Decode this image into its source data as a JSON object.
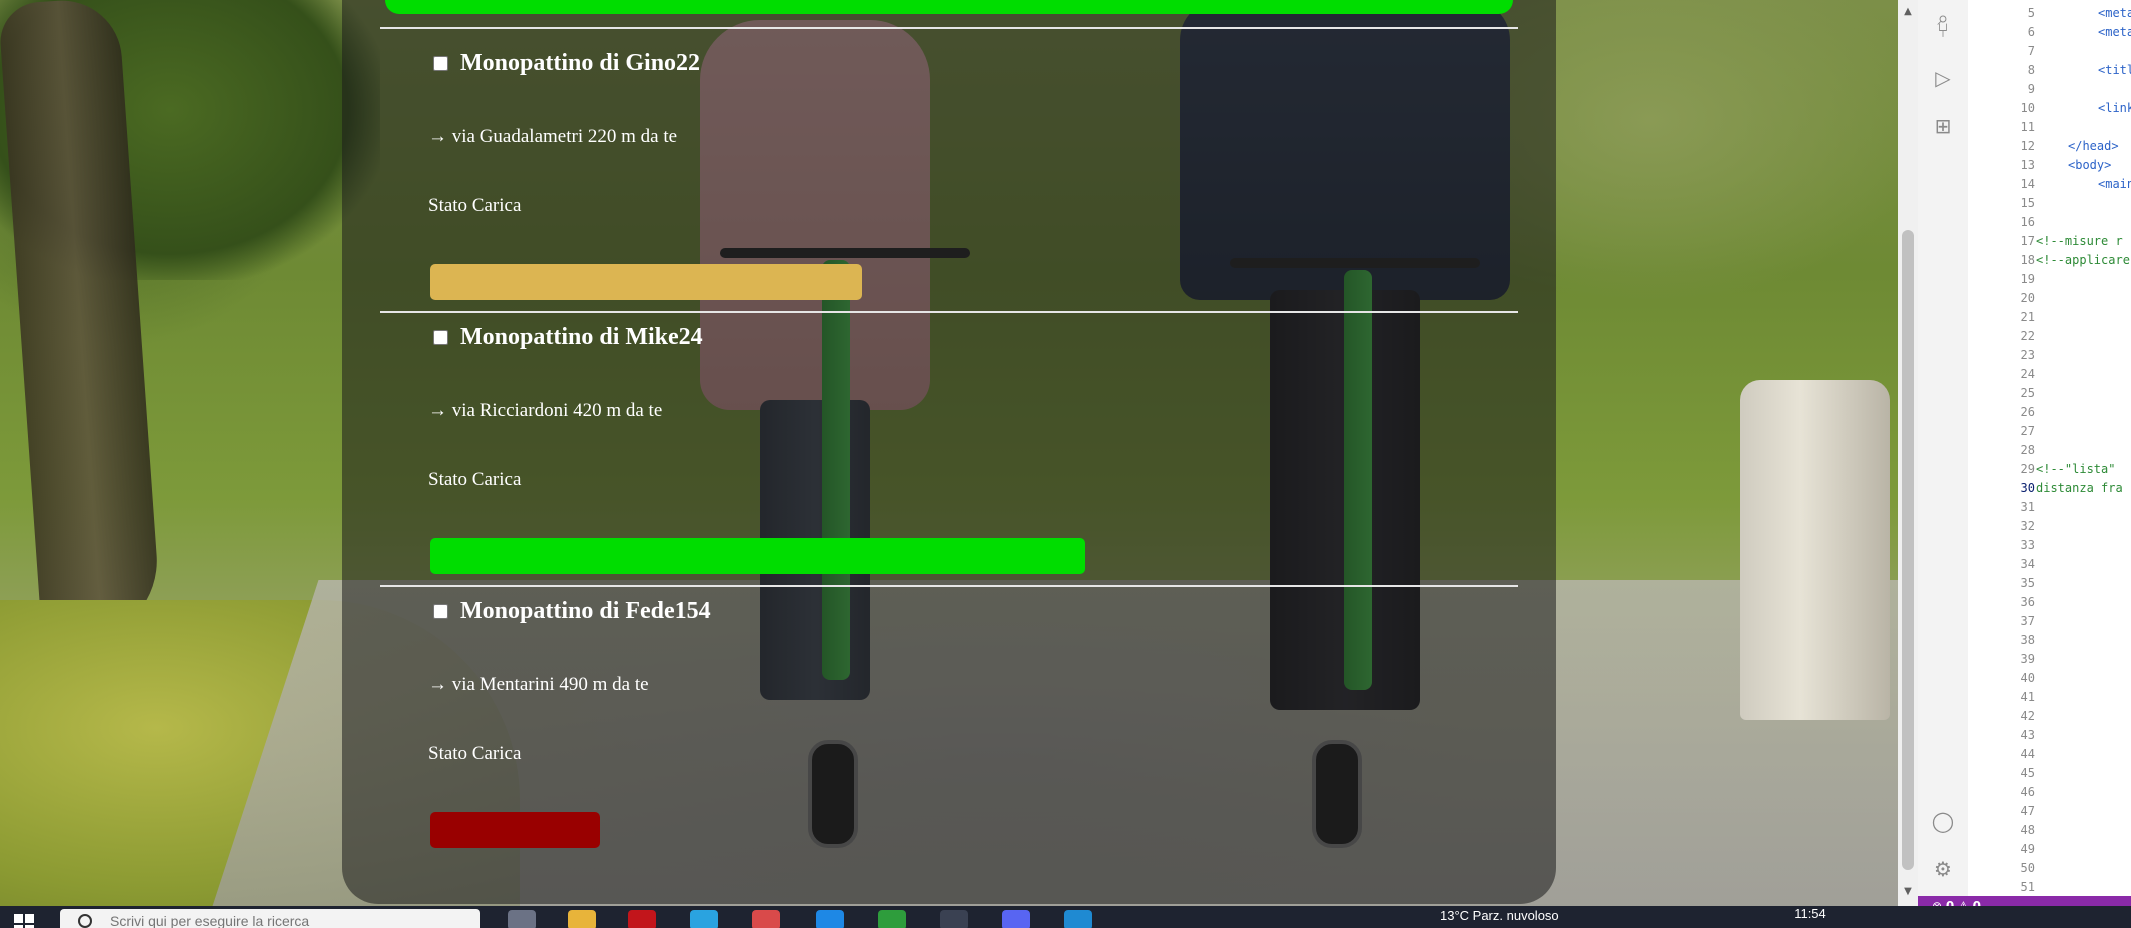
{
  "page": {
    "items": [
      {
        "title": "Monopattino di Gino22",
        "location": "→ via Guadalametri 220 m da te",
        "charge_label": "Stato Carica",
        "charge_level": 0.33,
        "charge_color": "#dcb552"
      },
      {
        "title": "Monopattino di Mike24",
        "location": "→ via Ricciardoni 420 m da te",
        "charge_label": "Stato Carica",
        "charge_level": 0.5,
        "charge_color": "#00dd00"
      },
      {
        "title": "Monopattino di Fede154",
        "location": "→ via Mentarini 490 m da te",
        "charge_label": "Stato Carica",
        "charge_level": 0.13,
        "charge_color": "#990000"
      }
    ],
    "top_bar_color": "#00dd00"
  },
  "editor": {
    "line_numbers": [
      "5",
      "6",
      "7",
      "8",
      "9",
      "10",
      "11",
      "12",
      "13",
      "14",
      "15",
      "16",
      "17",
      "18",
      "19",
      "20",
      "21",
      "22",
      "23",
      "24",
      "25",
      "26",
      "27",
      "28",
      "29",
      "30",
      "31",
      "32",
      "33",
      "34",
      "35",
      "36",
      "37",
      "38",
      "39",
      "40",
      "41",
      "42",
      "43",
      "44",
      "45",
      "46",
      "47",
      "48",
      "49",
      "50",
      "51"
    ],
    "active_line": "30",
    "code_fragments": {
      "meta1": "<meta",
      "meta2": "<meta",
      "title": "<titl",
      "link": "<link",
      "head_close": "</head>",
      "body_open": "<body>",
      "main": "<main",
      "comment_misure": "<!--misure r",
      "comment_applicare": "<!--applicare",
      "comment_lista": "<!--\"lista\"",
      "comment_distanza": "distanza fra"
    },
    "status": {
      "errors": "0",
      "warnings": "0"
    }
  },
  "taskbar": {
    "search_placeholder": "Scrivi qui per eseguire la ricerca",
    "weather": "13°C  Parz. nuvoloso",
    "clock": "11:54"
  }
}
